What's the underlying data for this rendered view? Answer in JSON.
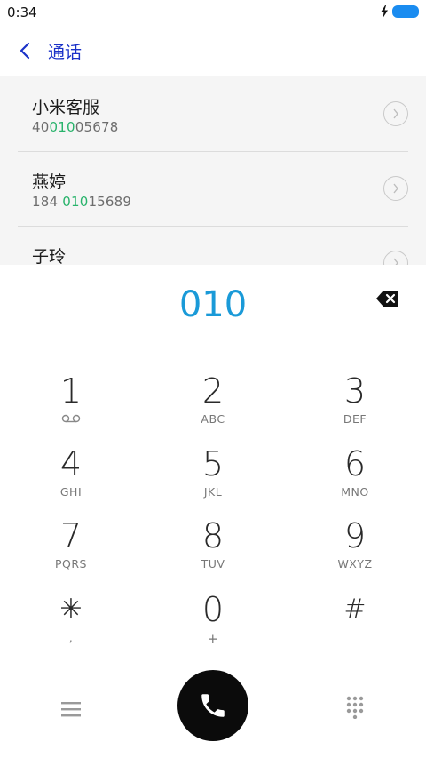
{
  "status_bar": {
    "time": "0:34"
  },
  "header": {
    "title": "通话"
  },
  "contacts": [
    {
      "name": "小米客服",
      "number_pre": "40",
      "number_match": "010",
      "number_post": "05678"
    },
    {
      "name": "燕婷",
      "number_pre": "184 ",
      "number_match": "010",
      "number_post": "15689"
    },
    {
      "name": "子玲",
      "number_pre": "",
      "number_match": "",
      "number_post": ""
    }
  ],
  "dialer": {
    "input": "010"
  },
  "keypad": [
    {
      "digit": "1",
      "letters": ""
    },
    {
      "digit": "2",
      "letters": "ABC"
    },
    {
      "digit": "3",
      "letters": "DEF"
    },
    {
      "digit": "4",
      "letters": "GHI"
    },
    {
      "digit": "5",
      "letters": "JKL"
    },
    {
      "digit": "6",
      "letters": "MNO"
    },
    {
      "digit": "7",
      "letters": "PQRS"
    },
    {
      "digit": "8",
      "letters": "TUV"
    },
    {
      "digit": "9",
      "letters": "WXYZ"
    },
    {
      "digit": "✳",
      "letters": ","
    },
    {
      "digit": "0",
      "letters": "+"
    },
    {
      "digit": "#",
      "letters": ""
    }
  ],
  "colors": {
    "accent": "#1a9ad8",
    "match_highlight": "#28b36b",
    "title": "#1a31c8",
    "battery": "#1a8cf0",
    "call_button": "#0b0b0b"
  },
  "icons": {
    "back": "back-icon",
    "voicemail": "voicemail-icon",
    "backspace": "backspace-icon",
    "menu": "menu-icon",
    "call": "phone-icon",
    "keypad": "keypad-icon"
  }
}
